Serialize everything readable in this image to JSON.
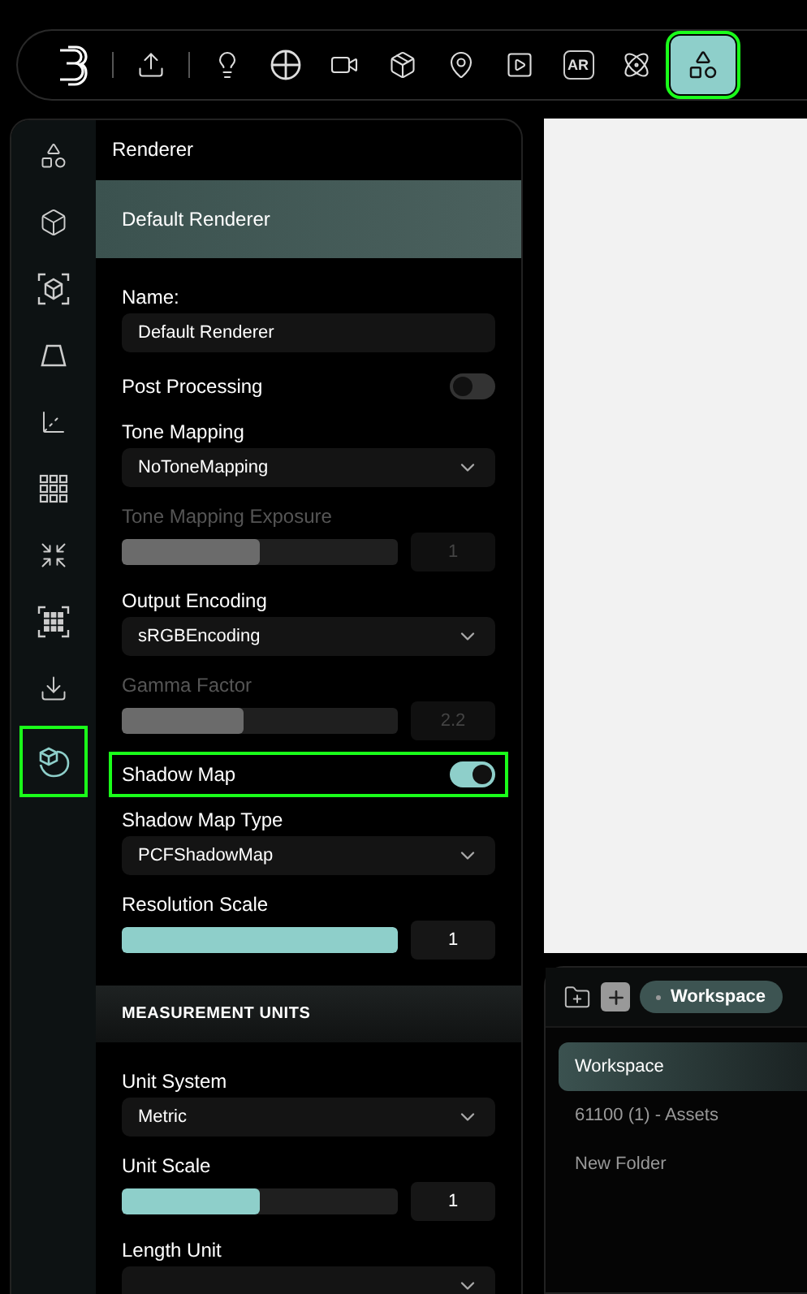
{
  "toolbar": {
    "items": [
      {
        "kind": "bulb",
        "selected": false
      },
      {
        "kind": "crosshair",
        "selected": false
      },
      {
        "kind": "camera",
        "selected": false
      },
      {
        "kind": "box-gear",
        "selected": false
      },
      {
        "kind": "pin",
        "selected": false
      },
      {
        "kind": "video",
        "selected": false
      },
      {
        "kind": "ar",
        "label": "AR",
        "selected": false
      },
      {
        "kind": "atom",
        "selected": false
      },
      {
        "kind": "scene",
        "selected": true
      }
    ]
  },
  "sidebar": {
    "items": [
      {
        "kind": "scene",
        "selected": false
      },
      {
        "kind": "box",
        "selected": false
      },
      {
        "kind": "box-frame",
        "selected": false
      },
      {
        "kind": "trapezoid",
        "selected": false
      },
      {
        "kind": "axes",
        "selected": false
      },
      {
        "kind": "grid",
        "selected": false
      },
      {
        "kind": "shrink",
        "selected": false
      },
      {
        "kind": "grid-frame",
        "selected": false
      },
      {
        "kind": "download",
        "selected": false
      },
      {
        "kind": "leaf-box",
        "selected": true
      }
    ]
  },
  "panel": {
    "title": "Renderer",
    "header": "Default Renderer",
    "sections": [
      {
        "fields": [
          {
            "kind": "text",
            "label": "Name:",
            "value": "Default Renderer",
            "disabled": false,
            "selected": false
          },
          {
            "kind": "toggle",
            "label": "Post Processing",
            "on": false,
            "disabled": false,
            "selected": false
          },
          {
            "kind": "select",
            "label": "Tone Mapping",
            "value": "NoToneMapping",
            "disabled": false,
            "selected": false
          },
          {
            "kind": "slider",
            "label": "Tone Mapping Exposure",
            "level": 0.5,
            "reading": "1",
            "disabled": true,
            "selected": false
          },
          {
            "kind": "select",
            "label": "Output Encoding",
            "value": "sRGBEncoding",
            "disabled": false,
            "selected": false
          },
          {
            "kind": "slider",
            "label": "Gamma Factor",
            "level": 0.44,
            "reading": "2.2",
            "disabled": true,
            "selected": false
          },
          {
            "kind": "toggle",
            "label": "Shadow Map",
            "on": true,
            "disabled": false,
            "selected": true
          },
          {
            "kind": "select",
            "label": "Shadow Map Type",
            "value": "PCFShadowMap",
            "disabled": false,
            "selected": false
          },
          {
            "kind": "slider",
            "label": "Resolution Scale",
            "level": 1,
            "reading": "1",
            "disabled": false,
            "selected": false
          }
        ]
      },
      {
        "title": "MEASUREMENT UNITS",
        "fields": [
          {
            "kind": "select",
            "label": "Unit System",
            "value": "Metric",
            "disabled": false,
            "selected": false
          },
          {
            "kind": "slider",
            "label": "Unit Scale",
            "level": 0.5,
            "reading": "1",
            "disabled": false,
            "selected": false
          },
          {
            "kind": "select",
            "label": "Length Unit",
            "disabled": false,
            "selected": false
          }
        ]
      }
    ]
  },
  "assets": {
    "breadcrumb": "Workspace",
    "items": [
      {
        "label": "Workspace",
        "selected": true
      },
      {
        "label": "61100 (1) - Assets",
        "selected": false
      },
      {
        "label": "New Folder",
        "selected": false
      }
    ]
  }
}
